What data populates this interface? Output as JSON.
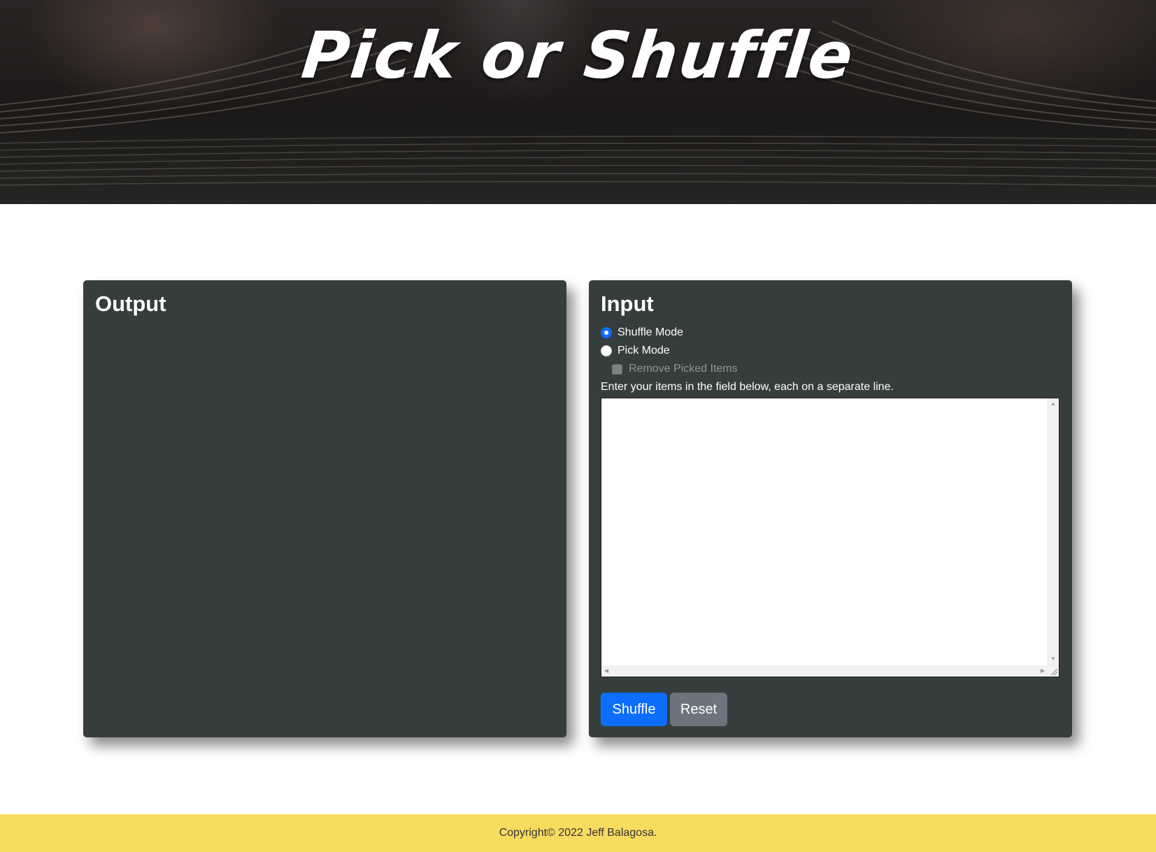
{
  "header": {
    "title": "Pick or Shuffle"
  },
  "output_panel": {
    "title": "Output"
  },
  "input_panel": {
    "title": "Input",
    "modes": [
      {
        "label": "Shuffle Mode",
        "checked": true
      },
      {
        "label": "Pick Mode",
        "checked": false
      }
    ],
    "remove_picked": {
      "label": "Remove Picked Items",
      "checked": false,
      "disabled": true
    },
    "hint": "Enter your items in the field below, each on a separate line.",
    "items_field": {
      "value": "",
      "placeholder": ""
    },
    "buttons": {
      "shuffle": "Shuffle",
      "reset": "Reset"
    }
  },
  "footer": {
    "copyright": "Copyright© 2022 Jeff Balagosa."
  },
  "colors": {
    "card_bg": "#363e3d",
    "primary": "#0d6efd",
    "secondary": "#6c757d",
    "footer_bg": "#f8dc60"
  }
}
